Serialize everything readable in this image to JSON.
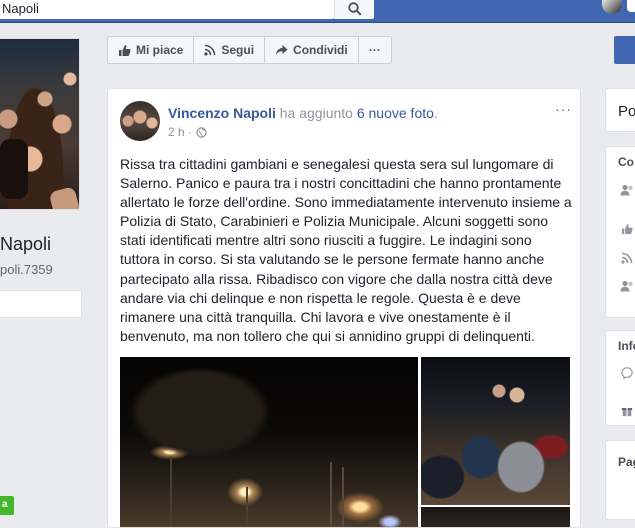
{
  "topbar": {
    "search_value": "Napoli"
  },
  "left": {
    "page_name": "Napoli",
    "page_handle": "poli.7359",
    "green_badge": "a"
  },
  "actions": {
    "like": "Mi piace",
    "follow": "Segui",
    "share": "Condividi",
    "more": "···"
  },
  "post": {
    "author": "Vincenzo Napoli",
    "verb": "ha aggiunto",
    "object": "6 nuove foto",
    "object_suffix": ".",
    "time": "2 h ·",
    "menu": "···",
    "text": "Rissa tra cittadini gambiani e senegalesi questa sera sul lungomare di Salerno. Panico e paura tra i nostri concittadini che hanno prontamente allertato le forze dell'ordine. Sono immediatamente intervenuto insieme a Polizia di Stato, Carabinieri e Polizia Municipale. Alcuni soggetti sono stati identificati mentre altri sono riusciti a fuggire. Le indagini sono tuttora in corso. Si sta valutando se le persone fermate hanno anche partecipato alla rissa. Ribadisco con vigore che dalla nostra città deve andare via chi delinque e non rispetta le regole. Questa è e deve rimanere una città tranquilla. Chi lavora e vive onestamente è il benvenuto, ma non tollero che qui si annidino gruppi di delinquenti."
  },
  "right": {
    "box1_title": "Po",
    "box2_title": "Co",
    "box3_title": "Info",
    "box4_title": "Pag"
  },
  "colors": {
    "brand_blue": "#4267b2",
    "link_blue": "#365899",
    "green": "#42b72a"
  }
}
